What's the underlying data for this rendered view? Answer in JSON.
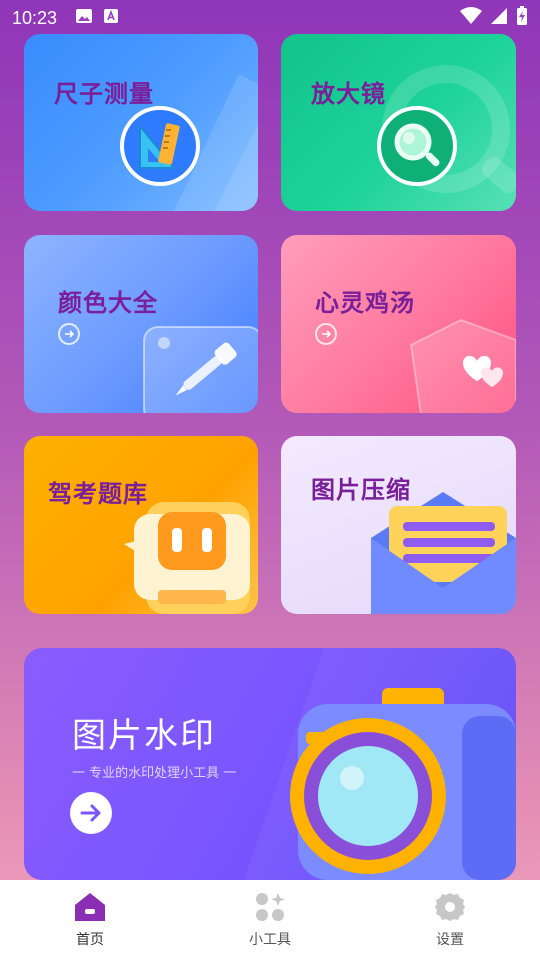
{
  "status_bar": {
    "time": "10:23"
  },
  "cards": {
    "ruler": {
      "title": "尺子测量"
    },
    "magnifier": {
      "title": "放大镜"
    },
    "color": {
      "title": "颜色大全"
    },
    "soul": {
      "title": "心灵鸡汤"
    },
    "driving": {
      "title": "驾考题库"
    },
    "compress": {
      "title": "图片压缩"
    }
  },
  "banner": {
    "title": "图片水印",
    "subtitle": "一 专业的水印处理小工具 一"
  },
  "tabbar": {
    "items": [
      {
        "label": "首页",
        "icon": "home-icon",
        "active": true
      },
      {
        "label": "小工具",
        "icon": "tools-icon",
        "active": false
      },
      {
        "label": "设置",
        "icon": "settings-icon",
        "active": false
      }
    ]
  },
  "colors": {
    "accent_purple": "#7a1f9a",
    "tab_active": "#8a2fb3",
    "tab_inactive": "#c7c7c7"
  }
}
